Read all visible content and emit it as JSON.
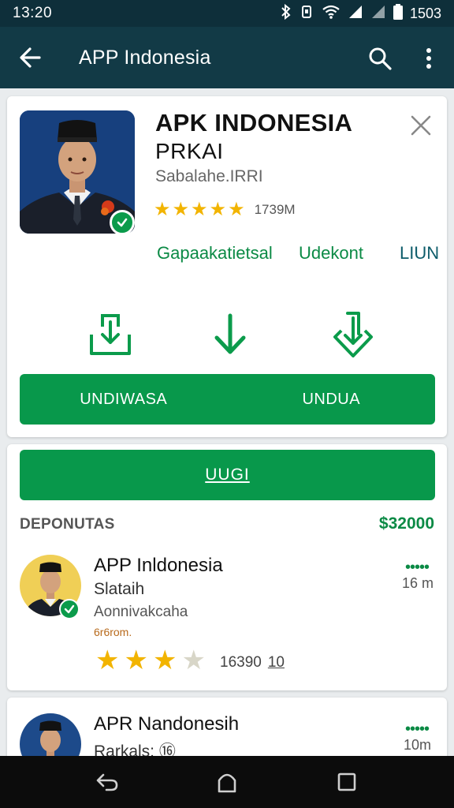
{
  "status": {
    "time": "13:20",
    "clock_right": "1503"
  },
  "appbar": {
    "title": "APP Indonesia"
  },
  "app": {
    "name": "APK INDONESIA",
    "subtitle": "PRKAI",
    "developer": "Sabalahe.IRRI",
    "stars": 5,
    "rating_count": "1739M",
    "links": [
      "Gapaakatietsal",
      "Udekont",
      "LIUN"
    ]
  },
  "buttons": {
    "left": "UNDIWASA",
    "right": "UNDUA",
    "big": "UUGI"
  },
  "section": {
    "label": "DEPONUTAS",
    "price": "$32000"
  },
  "items": [
    {
      "title": "APP Inldonesia",
      "subtitle": "Slataih",
      "desc": "Aonnivakcaha",
      "tag": "6r6rom.",
      "dots": "•••••",
      "time": "16 m",
      "stars_on": 3,
      "rating": "16390",
      "rating_extra": "10"
    },
    {
      "title": "APR Nandonesih",
      "subtitle": "Rarkals: ⑯",
      "dots": "•••••",
      "time": "10m"
    }
  ],
  "colors": {
    "statusbar": "#0e2f3a",
    "appbar": "#123a46",
    "accent_green": "#08984b",
    "star": "#f2b400"
  },
  "icons": [
    "back-arrow-icon",
    "search-icon",
    "more-vert-icon",
    "close-icon",
    "download-box-icon",
    "download-arrow-icon",
    "download-shield-icon",
    "nav-back-icon",
    "nav-home-icon",
    "nav-recents-icon"
  ]
}
